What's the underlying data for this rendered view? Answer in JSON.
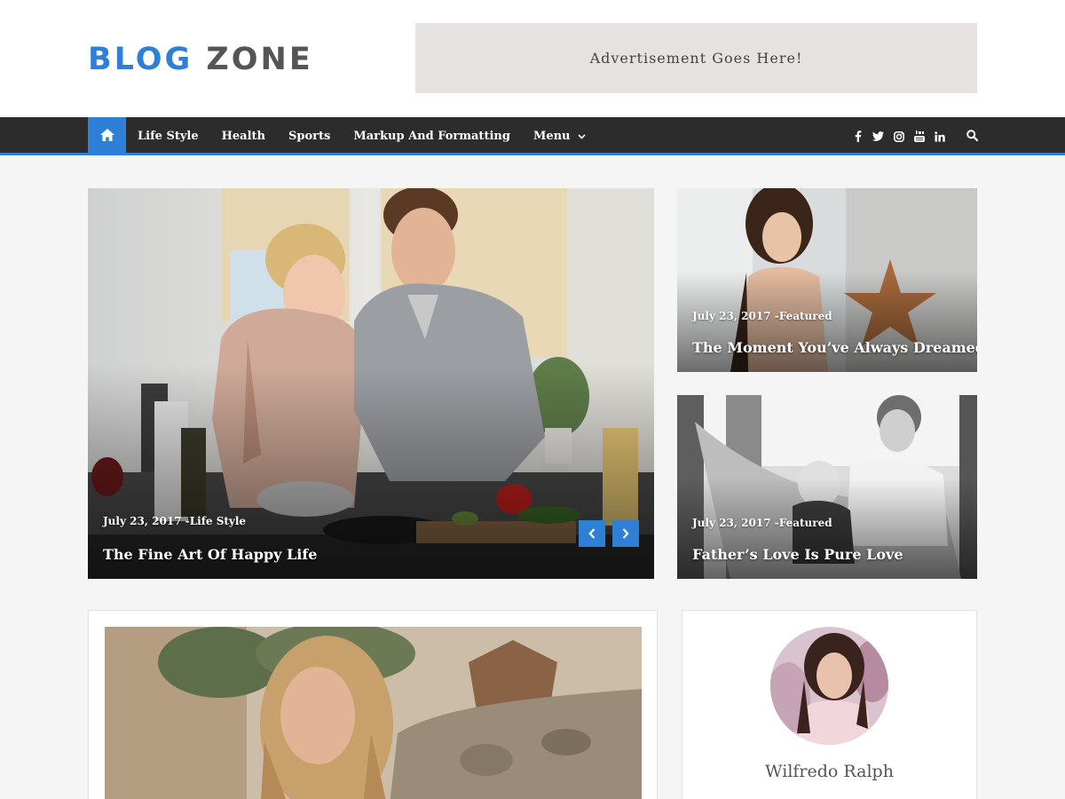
{
  "site": {
    "logo_word1": "BLOG",
    "logo_word2": "ZONE",
    "advertisement": "Advertisement Goes Here!"
  },
  "colors": {
    "accent": "#2e7fd6",
    "nav_bg": "#2c2c2c",
    "page_bg": "#f5f5f5"
  },
  "nav": {
    "home_icon": "home-icon",
    "items": [
      {
        "label": "Life Style"
      },
      {
        "label": "Health"
      },
      {
        "label": "Sports"
      },
      {
        "label": "Markup And Formatting"
      },
      {
        "label": "Menu"
      }
    ],
    "social_icons": [
      "facebook-icon",
      "twitter-icon",
      "instagram-icon",
      "youtube-icon",
      "linkedin-icon"
    ],
    "search_icon": "search-icon"
  },
  "slider": {
    "meta": "July 23, 2017 -Life Style",
    "title": "The Fine Art Of Happy Life"
  },
  "featured": [
    {
      "meta": "July 23, 2017 -Featured",
      "title": "The Moment You’ve Always Dreamed"
    },
    {
      "meta": "July 23, 2017 -Featured",
      "title": "Father’s Love Is Pure Love"
    }
  ],
  "author": {
    "name": "Wilfredo Ralph"
  }
}
